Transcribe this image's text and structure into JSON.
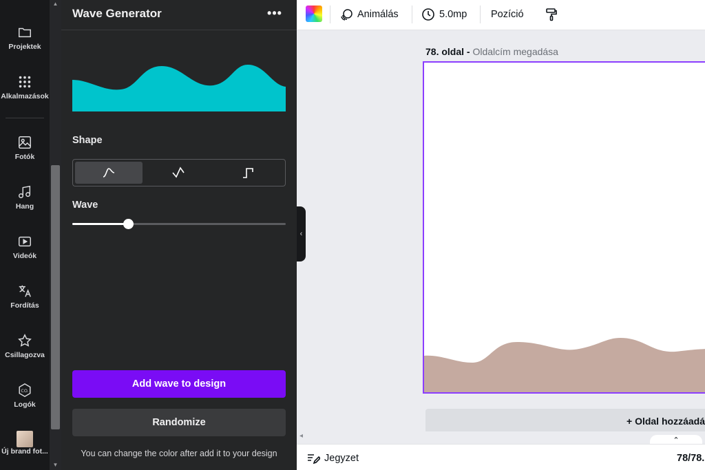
{
  "rail": {
    "items": [
      {
        "label": "Projektek",
        "icon": "folder-icon"
      },
      {
        "label": "Alkalmazások",
        "icon": "apps-grid-icon"
      },
      {
        "label": "Fotók",
        "icon": "image-icon"
      },
      {
        "label": "Hang",
        "icon": "music-note-icon"
      },
      {
        "label": "Videók",
        "icon": "video-icon"
      },
      {
        "label": "Fordítás",
        "icon": "translate-icon"
      },
      {
        "label": "Csillagozva",
        "icon": "star-icon"
      },
      {
        "label": "Logók",
        "icon": "logo-icon"
      },
      {
        "label": "Új brand fot...",
        "icon": "brand-photo-thumbnail"
      }
    ]
  },
  "panel": {
    "title": "Wave Generator",
    "more_icon": "more-horizontal-icon",
    "preview_color": "#00c4cc",
    "shape_label": "Shape",
    "shapes": [
      {
        "name": "smooth-wave-icon",
        "active": true
      },
      {
        "name": "peaked-wave-icon",
        "active": false
      },
      {
        "name": "step-wave-icon",
        "active": false
      }
    ],
    "wave_label": "Wave",
    "wave_level": 0.26,
    "add_button": "Add wave to design",
    "randomize_button": "Randomize",
    "hint": "You can change the color after add it to your design"
  },
  "toolbar": {
    "animate_label": "Animálás",
    "duration_label": "5.0mp",
    "position_label": "Pozíció"
  },
  "canvas": {
    "page_number": "78. oldal -",
    "page_title_placeholder": "Oldalcím megadása",
    "wave_color": "#c5aaa0",
    "add_page": "+ Oldal hozzáadá"
  },
  "bottom": {
    "notes_label": "Jegyzet",
    "page_count": "78/78."
  },
  "colors": {
    "accent": "#7a0cf5",
    "selection": "#8b3dff",
    "panel_bg": "#252627",
    "rail_bg": "#18191b"
  }
}
